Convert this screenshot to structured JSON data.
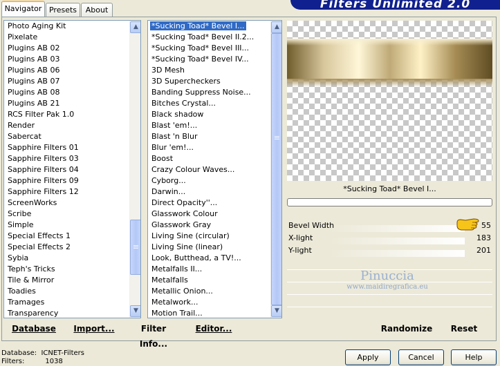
{
  "tabs": [
    {
      "label": "Navigator",
      "active": true
    },
    {
      "label": "Presets",
      "active": false
    },
    {
      "label": "About",
      "active": false
    }
  ],
  "banner_title": "Filters Unlimited 2.0",
  "categories": [
    "Photo Aging Kit",
    "Pixelate",
    "Plugins AB 02",
    "Plugins AB 03",
    "Plugins AB 06",
    "Plugins AB 07",
    "Plugins AB 08",
    "Plugins AB 21",
    "RCS Filter Pak 1.0",
    "Render",
    "Sabercat",
    "Sapphire Filters 01",
    "Sapphire Filters 03",
    "Sapphire Filters 04",
    "Sapphire Filters 09",
    "Sapphire Filters 12",
    "ScreenWorks",
    "Scribe",
    "Simple",
    "Special Effects 1",
    "Special Effects 2",
    "Sybia",
    "Teph's Tricks",
    "Tile & Mirror",
    "Toadies",
    "Tramages",
    "Transparency"
  ],
  "selected_category": "Toadies",
  "filters": [
    "*Sucking Toad*  Bevel I...",
    "*Sucking Toad*  Bevel II.2...",
    "*Sucking Toad*  Bevel III...",
    "*Sucking Toad*  Bevel IV...",
    "3D Mesh",
    "3D Supercheckers",
    "Banding Suppress Noise...",
    "Bitches Crystal...",
    "Black shadow",
    "Blast 'em!...",
    "Blast 'n Blur",
    "Blur 'em!...",
    "Boost",
    "Crazy Colour Waves...",
    "Cyborg...",
    "Darwin...",
    "Direct Opacity''...",
    "Glasswork Colour",
    "Glasswork Gray",
    "Living Sine (circular)",
    "Living Sine (linear)",
    "Look, Butthead, a TV!...",
    "Metalfalls II...",
    "Metalfalls",
    "Metallic Onion...",
    "Metalwork...",
    "Motion Trail..."
  ],
  "selected_filter": "*Sucking Toad*  Bevel I...",
  "preview_caption": "*Sucking Toad*  Bevel I...",
  "params": [
    {
      "label": "Bevel Width",
      "value": "55"
    },
    {
      "label": "X-light",
      "value": "183"
    },
    {
      "label": "Y-light",
      "value": "201"
    }
  ],
  "watermark": {
    "name": "Pinuccia",
    "url": "www.maidiregrafica.eu"
  },
  "toolbar": {
    "database": "Database",
    "import": "Import...",
    "filter_info": "Filter Info...",
    "editor": "Editor...",
    "randomize": "Randomize",
    "reset": "Reset"
  },
  "status": {
    "database_label": "Database:",
    "database_value": "ICNET-Filters",
    "filters_label": "Filters:",
    "filters_value": "1038"
  },
  "buttons": {
    "apply": "Apply",
    "cancel": "Cancel",
    "help": "Help"
  },
  "colors": {
    "selection": "#316ac5",
    "banner": "#10208e",
    "tab_accent": "#f9b74a"
  }
}
